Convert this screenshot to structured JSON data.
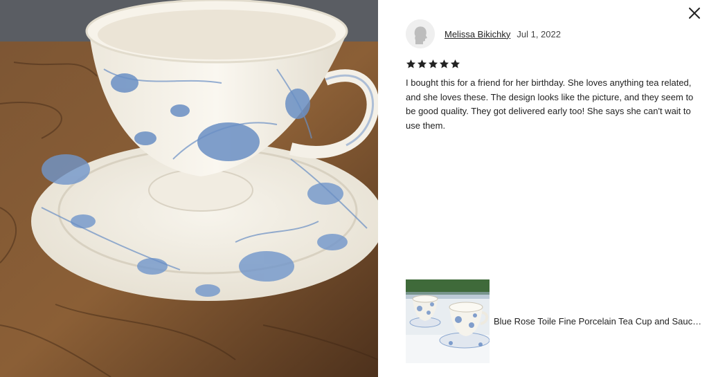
{
  "photo": {
    "icon": "teacup-photo",
    "colors": {
      "wood": "#7a5230",
      "porcelain": "#f3efe6",
      "pattern": "#6a8fc4"
    }
  },
  "close": {
    "icon": "close-icon"
  },
  "review": {
    "reviewer_name": "Melissa Bikichky",
    "date": "Jul 1, 2022",
    "rating": 5,
    "rating_max": 5,
    "text": "I bought this for a friend for her birthday. She loves anything tea related, and she loves these. The design looks like the picture, and they seem to be good quality. They got delivered early too! She says she can't wait to use them."
  },
  "product": {
    "title": "Blue Rose Toile Fine Porcelain Tea Cup and Saucer Set"
  }
}
